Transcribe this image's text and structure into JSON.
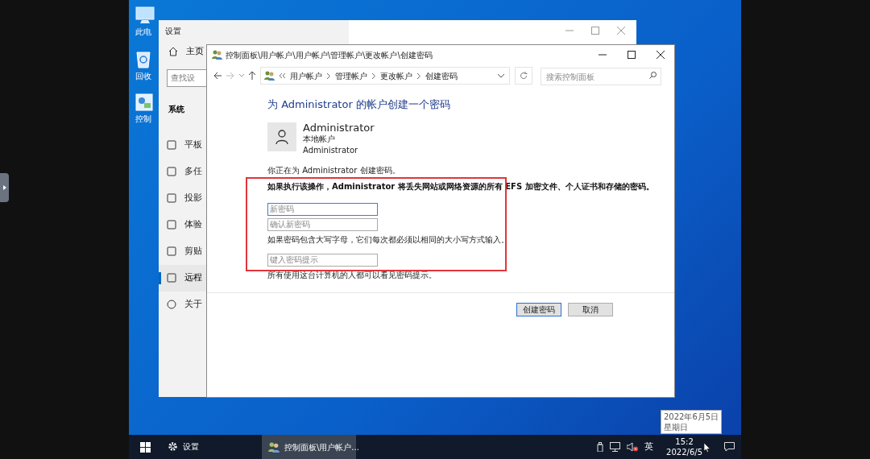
{
  "desktop_icons": [
    {
      "label": "此电"
    },
    {
      "label": "回收"
    },
    {
      "label": "控制"
    }
  ],
  "settings_window": {
    "title": "设置",
    "home_label": "主页",
    "search_placeholder": "查找设",
    "section": "系统",
    "nav_items": [
      {
        "label": "平板",
        "selected": false
      },
      {
        "label": "多任",
        "selected": false
      },
      {
        "label": "投影",
        "selected": false
      },
      {
        "label": "体验",
        "selected": false
      },
      {
        "label": "剪贴",
        "selected": false
      },
      {
        "label": "远程",
        "selected": true
      },
      {
        "label": "关于",
        "selected": false
      }
    ]
  },
  "control_panel_window": {
    "title": "控制面板\\用户帐户\\用户帐户\\管理帐户\\更改帐户\\创建密码",
    "breadcrumb": [
      "用户帐户",
      "管理帐户",
      "更改帐户",
      "创建密码"
    ],
    "search_placeholder": "搜索控制面板",
    "heading": "为 Administrator 的帐户创建一个密码",
    "account": {
      "name": "Administrator",
      "type": "本地帐户",
      "detail": "Administrator"
    },
    "intro": "你正在为 Administrator 创建密码。",
    "warning": "如果执行该操作，Administrator 将丢失网站或网络资源的所有 EFS 加密文件、个人证书和存储的密码。",
    "form": [
      {
        "kind": "field",
        "placeholder": "新密码",
        "focused": true
      },
      {
        "kind": "field",
        "placeholder": "确认新密码",
        "focused": false
      },
      {
        "kind": "note",
        "text": "如果密码包含大写字母，它们每次都必须以相同的大小写方式输入。"
      },
      {
        "kind": "field",
        "placeholder": "键入密码提示",
        "focused": false
      },
      {
        "kind": "note",
        "text": "所有使用这台计算机的人都可以看见密码提示。"
      }
    ],
    "buttons": [
      {
        "label": "创建密码",
        "default": true
      },
      {
        "label": "取消",
        "default": false
      }
    ]
  },
  "taskbar": {
    "apps": [
      {
        "label": "设置",
        "active": false,
        "kind": "gear"
      },
      {
        "label": "控制面板\\用户帐户...",
        "active": true,
        "kind": "users"
      }
    ],
    "input_method": "英",
    "time": "15:2",
    "date": "2022/6/5",
    "tooltip": [
      "2022年6月5日",
      "星期日"
    ]
  }
}
